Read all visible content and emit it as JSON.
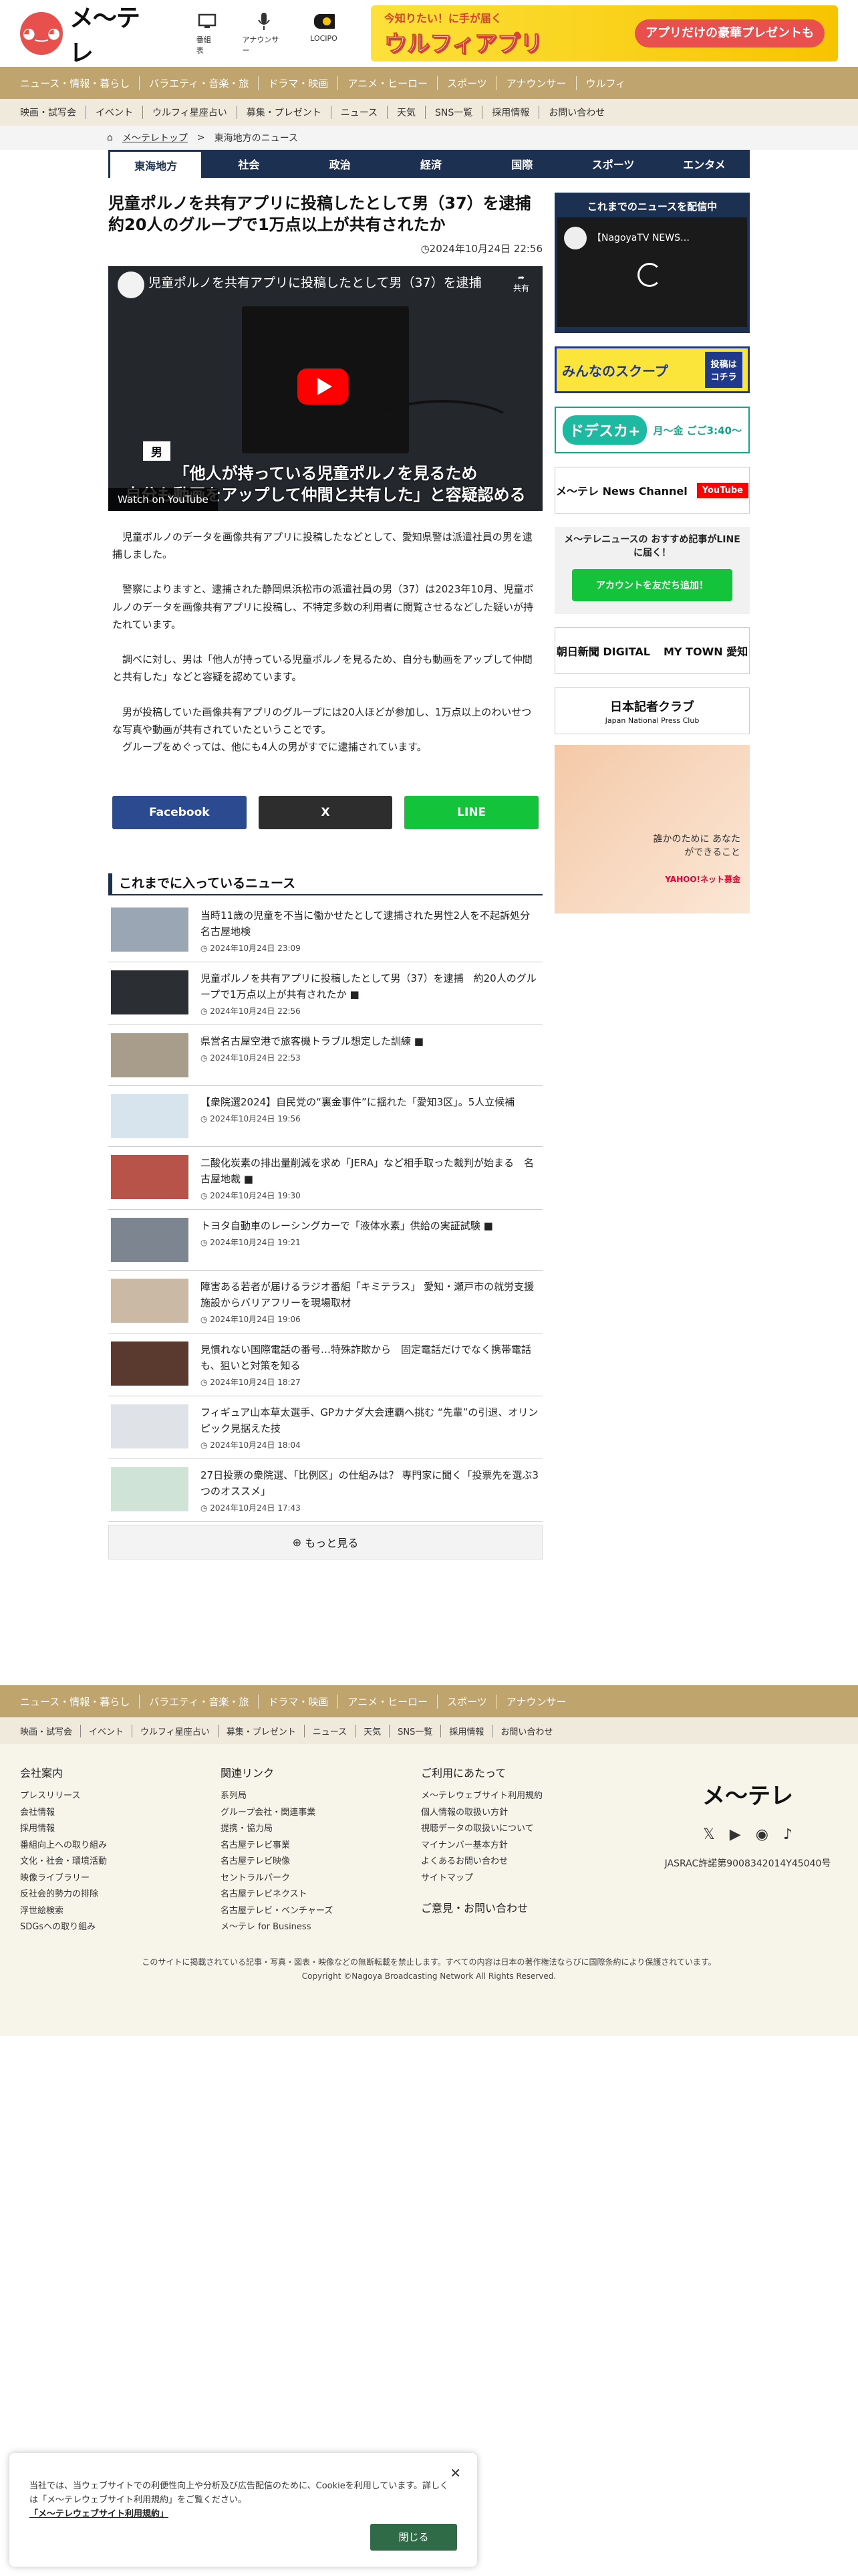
{
  "header": {
    "logo_text": "メ〜テレ",
    "icons": [
      {
        "label": "番組表",
        "icon": "tv-icon"
      },
      {
        "label": "アナウンサー",
        "icon": "microphone-icon"
      },
      {
        "label": "LOCIPO",
        "icon": "locipo-icon"
      }
    ],
    "banner": {
      "line1": "今知りたい！に手が届く",
      "line2": "ウルフィアプリ",
      "line3": "アプリだけの豪華プレゼントも"
    }
  },
  "nav1": [
    "ニュース・情報・暮らし",
    "バラエティ・音楽・旅",
    "ドラマ・映画",
    "アニメ・ヒーロー",
    "スポーツ",
    "アナウンサー",
    "ウルフィ"
  ],
  "nav2": [
    "映画・試写会",
    "イベント",
    "ウルフィ星座占い",
    "募集・プレゼント",
    "ニュース",
    "天気",
    "SNS一覧",
    "採用情報",
    "お問い合わせ"
  ],
  "breadcrumb": {
    "home": "メ〜テレトップ",
    "sep": ">",
    "current": "東海地方のニュース"
  },
  "tabs": [
    "東海地方",
    "社会",
    "政治",
    "経済",
    "国際",
    "スポーツ",
    "エンタメ"
  ],
  "article": {
    "title": "児童ポルノを共有アプリに投稿したとして男（37）を逮捕　約20人のグループで1万点以上が共有されたか",
    "datetime": "2024年10月24日 22:56",
    "video": {
      "title": "児童ポルノを共有アプリに投稿したとして男（37）を逮捕",
      "share": "共有",
      "label": "男",
      "caption1": "「他人が持っている児童ポルノを見るため",
      "caption2": "自分も動画をアップして仲間と共有した」と容疑認める",
      "watch": "Watch on  YouTube"
    },
    "paragraphs": [
      "児童ポルノのデータを画像共有アプリに投稿したなどとして、愛知県警は派遣社員の男を逮捕しました。",
      "警察によりますと、逮捕された静岡県浜松市の派遣社員の男（37）は2023年10月、児童ポルノのデータを画像共有アプリに投稿し、不特定多数の利用者に閲覧させるなどした疑いが持たれています。",
      "調べに対し、男は「他人が持っている児童ポルノを見るため、自分も動画をアップして仲間と共有した」などと容疑を認めています。",
      "男が投稿していた画像共有アプリのグループには20人ほどが参加し、1万点以上のわいせつな写真や動画が共有されていたということです。",
      "グループをめぐっては、他にも4人の男がすでに逮捕されています。"
    ]
  },
  "share": {
    "facebook": "Facebook",
    "x": "X",
    "line": "LINE"
  },
  "news": {
    "heading": "これまでに入っているニュース",
    "items": [
      {
        "title": "当時11歳の児童を不当に働かせたとして逮捕された男性2人を不起訴処分　名古屋地検",
        "date": "2024年10月24日 23:09",
        "video": false
      },
      {
        "title": "児童ポルノを共有アプリに投稿したとして男（37）を逮捕　約20人のグループで1万点以上が共有されたか",
        "date": "2024年10月24日 22:56",
        "video": true
      },
      {
        "title": "県営名古屋空港で旅客機トラブル想定した訓練",
        "date": "2024年10月24日 22:53",
        "video": true
      },
      {
        "title": "【衆院選2024】自民党の“裏金事件”に揺れた「愛知3区」。5人立候補",
        "date": "2024年10月24日 19:56",
        "video": false
      },
      {
        "title": "二酸化炭素の排出量削減を求め「JERA」など相手取った裁判が始まる　名古屋地裁",
        "date": "2024年10月24日 19:30",
        "video": true
      },
      {
        "title": "トヨタ自動車のレーシングカーで「液体水素」供給の実証試験",
        "date": "2024年10月24日 19:21",
        "video": true
      },
      {
        "title": "障害ある若者が届けるラジオ番組「キミテラス」 愛知・瀬戸市の就労支援施設からバリアフリーを現場取材",
        "date": "2024年10月24日 19:06",
        "video": false
      },
      {
        "title": "見慣れない国際電話の番号…特殊詐欺から　固定電話だけでなく携帯電話も、狙いと対策を知る",
        "date": "2024年10月24日 18:27",
        "video": false
      },
      {
        "title": "フィギュア山本草太選手、GPカナダ大会連覇へ挑む “先輩”の引退、オリンピック見据えた技",
        "date": "2024年10月24日 18:04",
        "video": false
      },
      {
        "title": "27日投票の衆院選、「比例区」の仕組みは？ 専門家に聞く「投票先を選ぶ3つのオススメ」",
        "date": "2024年10月24日 17:43",
        "video": false
      }
    ],
    "more": "もっと見る"
  },
  "sidebar": {
    "box_title": "これまでのニュースを配信中",
    "box_video": "【NagoyaTV NEWS…",
    "banners": [
      {
        "text": "みんなのスクープ",
        "sub": "投稿はコチラ"
      },
      {
        "text": "ドデスカ+",
        "sub": "月〜金 ごご3:40〜"
      },
      {
        "text": "メ〜テレ News Channel",
        "sub": "YouTube"
      },
      {
        "text": "メ〜テレニュースの おすすめ記事がLINEに届く！",
        "sub": "アカウントを友だち追加！"
      },
      {
        "text": "朝日新聞 DIGITAL",
        "sub": "MY TOWN 愛知"
      },
      {
        "text": "日本記者クラブ",
        "sub": "Japan National Press Club"
      },
      {
        "text": "誰かのために あなたができること",
        "sub": "YAHOO!ネット募金"
      }
    ]
  },
  "footer": {
    "nav1": [
      "ニュース・情報・暮らし",
      "バラエティ・音楽・旅",
      "ドラマ・映画",
      "アニメ・ヒーロー",
      "スポーツ",
      "アナウンサー"
    ],
    "nav2": [
      "映画・試写会",
      "イベント",
      "ウルフィ星座占い",
      "募集・プレゼント",
      "ニュース",
      "天気",
      "SNS一覧",
      "採用情報",
      "お問い合わせ"
    ],
    "col1": {
      "title": "会社案内",
      "items": [
        "プレスリリース",
        "会社情報",
        "採用情報",
        "番組向上への取り組み",
        "文化・社会・環境活動",
        "映像ライブラリー",
        "反社会的勢力の排除",
        "浮世絵検索",
        "SDGsへの取り組み"
      ]
    },
    "col2": {
      "title": "関連リンク",
      "items": [
        "系列局",
        "グループ会社・関連事業",
        "提携・協力局",
        "名古屋テレビ事業",
        "名古屋テレビ映像",
        "セントラルパーク",
        "名古屋テレビネクスト",
        "名古屋テレビ・ベンチャーズ",
        "メ〜テレ for Business"
      ]
    },
    "col3": {
      "title": "ご利用にあたって",
      "items": [
        "メ〜テレウェブサイト利用規約",
        "個人情報の取扱い方針",
        "視聴データの取扱いについて",
        "マイナンバー基本方針",
        "よくあるお問い合わせ",
        "サイトマップ"
      ],
      "extra": "ご意見・お問い合わせ"
    },
    "logo": "メ〜テレ",
    "jasrac": "JASRAC許諾第9008342014Y45040号",
    "note": "このサイトに掲載されている記事・写真・図表・映像などの無断転載を禁止します。すべての内容は日本の著作権法ならびに国際条約により保護されています。",
    "copyright": "Copyright ©Nagoya Broadcasting Network All Rights Reserved."
  },
  "cookie": {
    "text1": "当社では、当ウェブサイトでの利便性向上や分析及び広告配信のために、Cookieを利用しています。詳しくは「メ〜テレウェブサイト利用規約」をご覧ください。",
    "link": "「メ〜テレウェブサイト利用規約」",
    "close": "閉じる"
  }
}
